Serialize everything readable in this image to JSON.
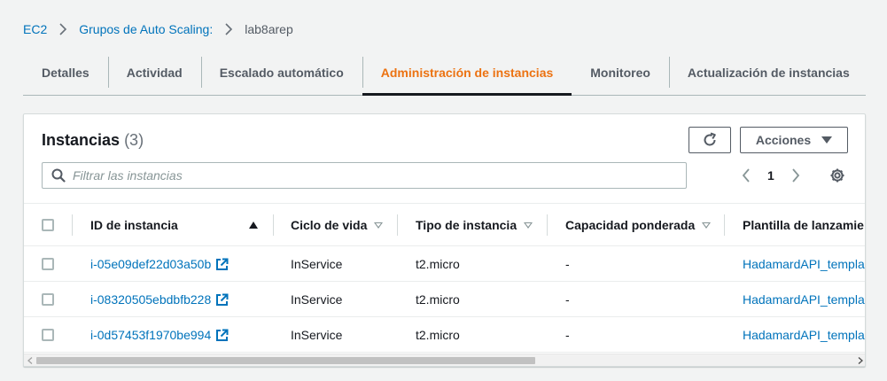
{
  "breadcrumb": {
    "items": [
      "EC2",
      "Grupos de Auto Scaling:"
    ],
    "current": "lab8arep"
  },
  "tabs": [
    {
      "label": "Detalles"
    },
    {
      "label": "Actividad"
    },
    {
      "label": "Escalado automático"
    },
    {
      "label": "Administración de instancias",
      "active": true
    },
    {
      "label": "Monitoreo"
    },
    {
      "label": "Actualización de instancias"
    }
  ],
  "panel": {
    "title": "Instancias",
    "count": "(3)",
    "actions_label": "Acciones",
    "search_placeholder": "Filtrar las instancias",
    "page_number": "1"
  },
  "table": {
    "columns": [
      "ID de instancia",
      "Ciclo de vida",
      "Tipo de instancia",
      "Capacidad ponderada",
      "Plantilla de lanzamie"
    ],
    "rows": [
      {
        "id": "i-05e09def22d03a50b",
        "lifecycle": "InService",
        "type": "t2.micro",
        "capacity": "-",
        "template": "HadamardAPI_templa"
      },
      {
        "id": "i-08320505ebdbfb228",
        "lifecycle": "InService",
        "type": "t2.micro",
        "capacity": "-",
        "template": "HadamardAPI_templa"
      },
      {
        "id": "i-0d57453f1970be994",
        "lifecycle": "InService",
        "type": "t2.micro",
        "capacity": "-",
        "template": "HadamardAPI_templa"
      }
    ]
  },
  "icons": {
    "breadcrumb_separator": "chevron-right-icon",
    "refresh": "refresh-icon",
    "actions_caret": "caret-down-icon",
    "search": "search-icon",
    "prev": "chevron-left-icon",
    "next": "chevron-right-icon",
    "settings": "gear-icon",
    "external_link": "external-link-icon",
    "sort_ascending": "sort-ascending-icon",
    "sort": "sort-icon"
  },
  "colors": {
    "active_tab": "#ec7211",
    "link": "#0073bb",
    "background": "#f2f3f3"
  }
}
